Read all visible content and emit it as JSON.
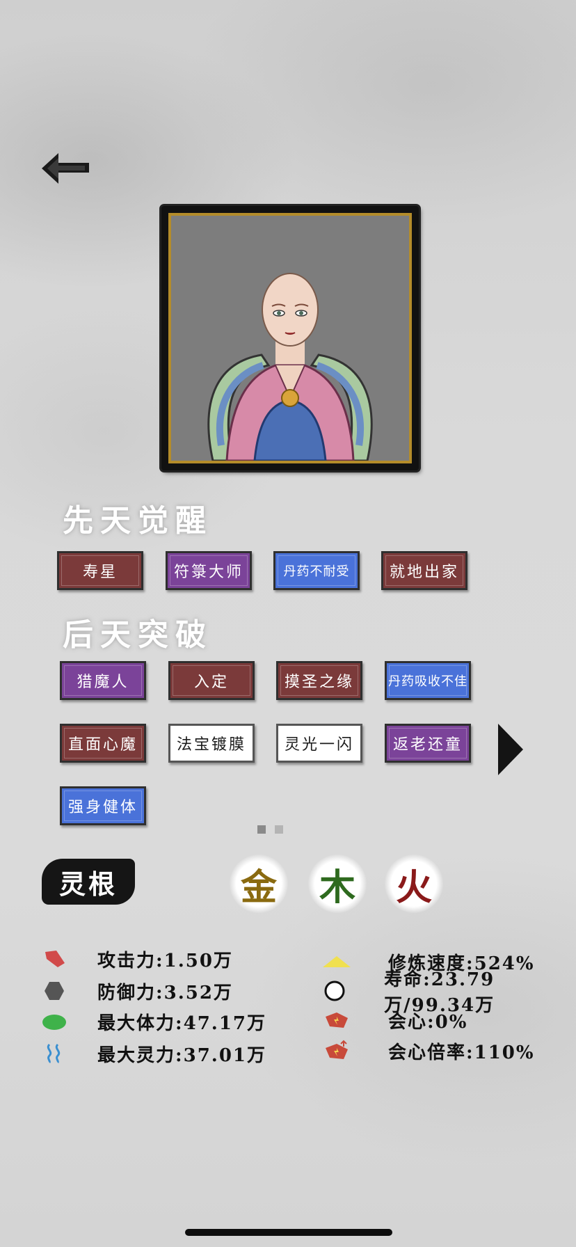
{
  "header": {
    "back_label": "back"
  },
  "sections": {
    "innate_title": "先天觉醒",
    "acquired_title": "后天突破"
  },
  "innate_tags": [
    {
      "label": "寿星",
      "color": "red"
    },
    {
      "label": "符箓大师",
      "color": "purple"
    },
    {
      "label": "丹药不耐受",
      "color": "blue"
    },
    {
      "label": "就地出家",
      "color": "red"
    }
  ],
  "acquired_tags": [
    {
      "label": "猎魔人",
      "color": "purple"
    },
    {
      "label": "入定",
      "color": "red"
    },
    {
      "label": "摸圣之缘",
      "color": "red"
    },
    {
      "label": "丹药吸收不佳",
      "color": "blue"
    },
    {
      "label": "直面心魔",
      "color": "red"
    },
    {
      "label": "法宝镀膜",
      "color": "white"
    },
    {
      "label": "灵光一闪",
      "color": "white"
    },
    {
      "label": "返老还童",
      "color": "purple"
    },
    {
      "label": "强身健体",
      "color": "blue"
    }
  ],
  "pagination": {
    "pages": 2,
    "current": 1
  },
  "spirit_root": {
    "label": "灵根",
    "elements": [
      {
        "char": "金",
        "color": "#8a6a10"
      },
      {
        "char": "木",
        "color": "#2e6a1e"
      },
      {
        "char": "火",
        "color": "#8a1a1a"
      }
    ]
  },
  "stats_left": [
    {
      "icon": "attack-icon",
      "text": "攻击力:1.50万"
    },
    {
      "icon": "defense-icon",
      "text": "防御力:3.52万"
    },
    {
      "icon": "health-icon",
      "text": "最大体力:47.17万"
    },
    {
      "icon": "spirit-icon",
      "text": "最大灵力:37.01万"
    }
  ],
  "stats_right": [
    {
      "icon": "cultivation-speed-icon",
      "text": "修炼速度:524%"
    },
    {
      "icon": "lifespan-icon",
      "text": "寿命:23.79万/99.34万"
    },
    {
      "icon": "critical-icon",
      "text": "会心:0%"
    },
    {
      "icon": "critical-multiplier-icon",
      "text": "会心倍率:110%"
    }
  ],
  "colors": {
    "tag_red": "#7b3a3a",
    "tag_purple": "#7b4399",
    "tag_blue": "#4a72d9",
    "frame_gold": "#b48c2a"
  }
}
